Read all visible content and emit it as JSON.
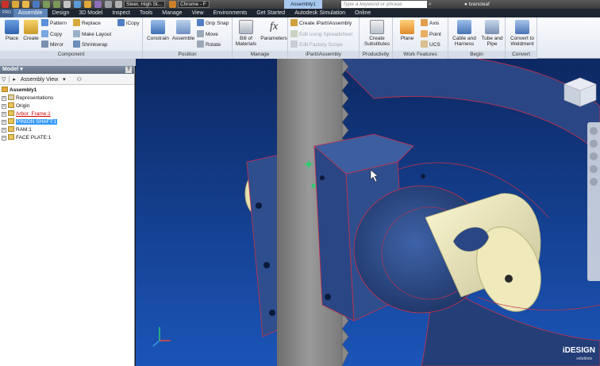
{
  "titlebar": {
    "material": "Steel, High St...",
    "appearance": "Chrome - F",
    "document": "Assembly1",
    "search_placeholder": "Type a keyword or phrase",
    "user": "tvancleaf"
  },
  "tabs": [
    {
      "label": "PRO"
    },
    {
      "label": "Assemble"
    },
    {
      "label": "Design"
    },
    {
      "label": "3D Model"
    },
    {
      "label": "Inspect"
    },
    {
      "label": "Tools"
    },
    {
      "label": "Manage"
    },
    {
      "label": "View"
    },
    {
      "label": "Environments"
    },
    {
      "label": "Get Started"
    },
    {
      "label": "Autodesk Simulation"
    },
    {
      "label": "Online"
    }
  ],
  "ribbon": {
    "component": {
      "title": "Component",
      "place": "Place",
      "create": "Create",
      "pattern": "Pattern",
      "copy": "Copy",
      "mirror": "Mirror",
      "replace": "Replace",
      "make_layout": "Make Layout",
      "shrinkwrap": "Shrinkwrap",
      "icopy": "iCopy"
    },
    "position": {
      "title": "Position",
      "constrain": "Constrain",
      "assemble": "Assemble",
      "grip_snap": "Grip Snap",
      "move": "Move",
      "rotate": "Rotate"
    },
    "manage": {
      "title": "Manage",
      "bom_line1": "Bill of",
      "bom_line2": "Materials",
      "parameters": "Parameters"
    },
    "ipart": {
      "title": "iPart/iAssembly",
      "create": "Create iPart/iAssembly",
      "edit_spreadsheet": "Edit using Spreadsheet",
      "edit_factory": "Edit Factory Scope"
    },
    "productivity": {
      "title": "Productivity",
      "line1": "Create",
      "line2": "Substitutes"
    },
    "work_features": {
      "title": "Work Features",
      "plane": "Plane",
      "axis": "Axis",
      "point": "Point",
      "ucs": "UCS"
    },
    "begin": {
      "title": "Begin",
      "cable_line1": "Cable and",
      "cable_line2": "Harness",
      "tube_line1": "Tube and",
      "tube_line2": "Pipe"
    },
    "convert": {
      "title": "Convert",
      "line1": "Convert to",
      "line2": "Weldment"
    }
  },
  "browser": {
    "title": "Model",
    "help": "?",
    "view": "Assembly View",
    "tree": [
      {
        "label": "Assembly1",
        "level": 0
      },
      {
        "label": "Representations",
        "level": 1
      },
      {
        "label": "Origin",
        "level": 1
      },
      {
        "label": "Arbor_Frame:1",
        "level": 1,
        "state": "error"
      },
      {
        "label": "PINION SHAFT:1",
        "level": 1,
        "state": "selected"
      },
      {
        "label": "RAM:1",
        "level": 1
      },
      {
        "label": "FACE PLATE:1",
        "level": 1
      }
    ]
  },
  "branding": {
    "logo": "iDESIGN",
    "sub": "solutions"
  },
  "colors": {
    "viewport_top": "#0f2c6e",
    "viewport_bottom": "#1a4fb0",
    "part_blue": "#2f4e8e",
    "shaft_yellow": "#e6e2b0",
    "edge_red": "#c8324a",
    "rack_gray": "#8c8c8c",
    "active_tab": "#5d84b8"
  }
}
